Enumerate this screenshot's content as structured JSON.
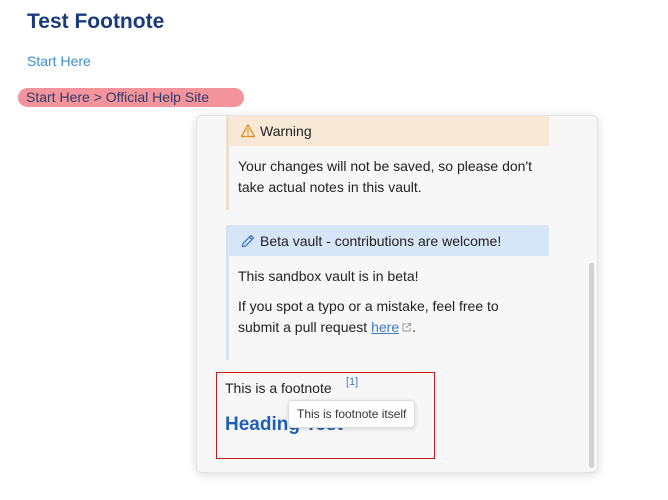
{
  "page": {
    "title": "Test Footnote",
    "start_link": "Start Here",
    "breadcrumb": "Start Here > Official Help Site"
  },
  "popover": {
    "warning": {
      "icon": "warning-triangle-icon",
      "title": "Warning",
      "body": "Your changes will not be saved, so please don't take actual notes in this vault."
    },
    "beta": {
      "icon": "pencil-icon",
      "title": "Beta vault - contributions are welcome!",
      "body1": "This sandbox vault is in beta!",
      "body2_prefix": "If you spot a typo or a mistake, feel free to submit a pull request ",
      "body2_link": "here",
      "link_icon": "external-link-icon",
      "body2_suffix": "."
    }
  },
  "footnote": {
    "text": "This is a footnote",
    "ref": "[1]",
    "tooltip": "This is footnote itself",
    "heading": "Heading Test"
  },
  "colors": {
    "title": "#1a3a7a",
    "link": "#3e8ed0",
    "breadcrumb_highlight": "#f3939b",
    "warning_header": "#f8e9d7",
    "beta_header": "#d6e6f6",
    "heading": "#2060b4",
    "annotation_box": "#c7171e"
  }
}
